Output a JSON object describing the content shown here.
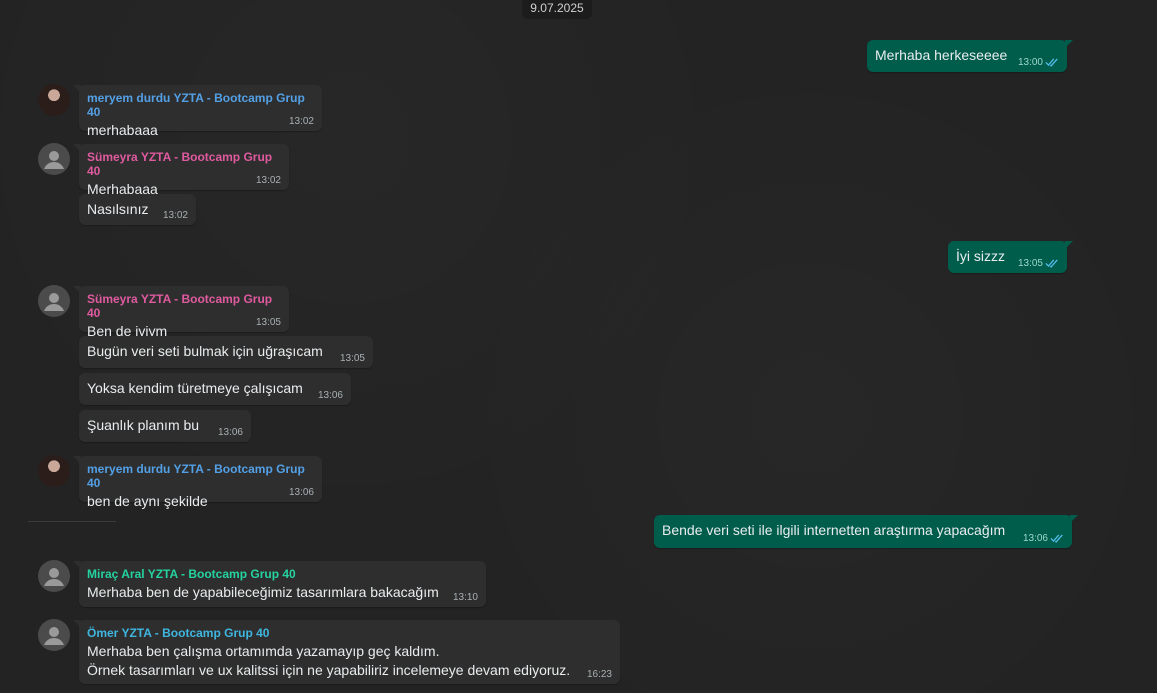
{
  "date_label": "9.07.2025",
  "colors": {
    "meryem": "#53a0e6",
    "sumeyra": "#e05aa0",
    "mirac": "#25d3a0",
    "omer": "#3fb6e0"
  },
  "messages": [
    {
      "text": "Merhaba herkeseeee",
      "time": "13:00"
    },
    {
      "sender": "meryem durdu YZTA - Bootcamp Grup 40",
      "text": "merhabaaa",
      "time": "13:02"
    },
    {
      "sender": "Sümeyra YZTA - Bootcamp Grup 40",
      "text": "Merhabaaa",
      "time": "13:02"
    },
    {
      "text": "Nasılsınız",
      "time": "13:02"
    },
    {
      "text": "İyi sizzz",
      "time": "13:05"
    },
    {
      "sender": "Sümeyra YZTA - Bootcamp Grup 40",
      "text": "Ben de iyiym",
      "time": "13:05"
    },
    {
      "text": "Bugün veri seti bulmak için uğraşıcam",
      "time": "13:05"
    },
    {
      "text": "Yoksa kendim türetmeye çalışıcam",
      "time": "13:06"
    },
    {
      "text": "Şuanlık planım bu",
      "time": "13:06"
    },
    {
      "sender": "meryem durdu YZTA - Bootcamp Grup 40",
      "text": "ben de aynı şekilde",
      "time": "13:06"
    },
    {
      "text": "Bende veri seti ile ilgili internetten araştırma yapacağım",
      "time": "13:06"
    },
    {
      "sender": "Miraç Aral YZTA - Bootcamp Grup 40",
      "text": "Merhaba ben de yapabileceğimiz tasarımlara bakacağım",
      "time": "13:10"
    },
    {
      "sender": "Ömer YZTA - Bootcamp Grup 40",
      "text": "Merhaba ben çalışma ortamımda yazamayıp geç kaldım.\nÖrnek tasarımları ve ux kalitssi için ne yapabiliriz incelemeye devam ediyoruz.",
      "time": "16:23"
    }
  ]
}
